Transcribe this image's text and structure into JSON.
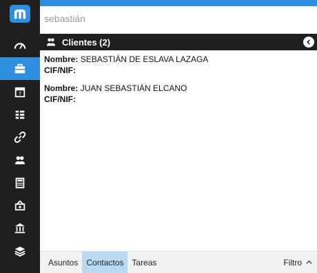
{
  "search": {
    "value": "sebastián"
  },
  "panel": {
    "title": "Clientes (2)"
  },
  "results": [
    {
      "name_label": "Nombre:",
      "name": "SEBASTIÁN DE ESLAVA LAZAGA",
      "cif_label": "CIF/NIF:"
    },
    {
      "name_label": "Nombre:",
      "name": "JUAN SEBASTIÁN ELCANO",
      "cif_label": "CIF/NIF:"
    }
  ],
  "tabs": [
    {
      "label": "Asuntos"
    },
    {
      "label": "Contactos"
    },
    {
      "label": "Tareas"
    }
  ],
  "filter": {
    "label": "Filtro"
  },
  "sidebar_icons": [
    "dashboard-icon",
    "briefcase-icon",
    "calendar-icon",
    "list-icon",
    "link-icon",
    "users-icon",
    "calculator-icon",
    "money-icon",
    "bank-icon",
    "layers-icon"
  ],
  "colors": {
    "accent": "#2f8fde",
    "sidebar": "#1f1f1f",
    "active_tab": "#b9d9f3"
  }
}
